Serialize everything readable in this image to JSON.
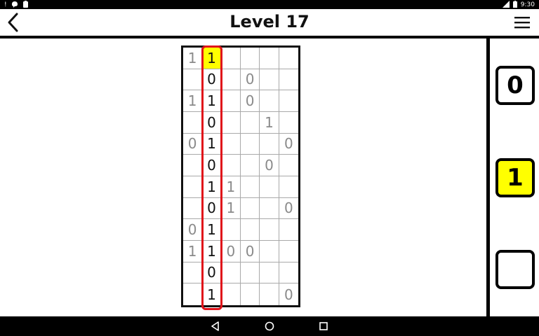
{
  "status_bar": {
    "left_icons": [
      "alert-icon",
      "messenger-icon",
      "clipboard-icon"
    ],
    "time": "9:30",
    "right_icons": [
      "signal-icon",
      "battery-icon"
    ]
  },
  "header": {
    "title": "Level 17",
    "back_icon": "chevron-left-icon",
    "menu_icon": "hamburger-menu-icon"
  },
  "board": {
    "columns": 6,
    "rows": 12,
    "cells": [
      [
        "1",
        "1",
        "",
        "",
        "",
        ""
      ],
      [
        "",
        "0",
        "",
        "0",
        "",
        ""
      ],
      [
        "1",
        "1",
        "",
        "0",
        "",
        ""
      ],
      [
        "",
        "0",
        "",
        "",
        "1",
        ""
      ],
      [
        "0",
        "1",
        "",
        "",
        "",
        "0"
      ],
      [
        "",
        "0",
        "",
        "",
        "0",
        ""
      ],
      [
        "",
        "1",
        "1",
        "",
        "",
        ""
      ],
      [
        "",
        "0",
        "1",
        "",
        "",
        "0"
      ],
      [
        "0",
        "1",
        "",
        "",
        "",
        ""
      ],
      [
        "1",
        "1",
        "0",
        "0",
        "",
        ""
      ],
      [
        "",
        "0",
        "",
        "",
        "",
        ""
      ],
      [
        "",
        "1",
        "",
        "",
        "",
        "0"
      ]
    ],
    "selected_cell": [
      0,
      1
    ],
    "highlighted_column": 1
  },
  "controls": {
    "zero_label": "0",
    "one_label": "1",
    "blank_label": ""
  },
  "colors": {
    "highlight": "#ffff00",
    "column_outline": "#e0121a",
    "filled_text": "#111111",
    "given_text": "#8a8a8a"
  },
  "nav_bar": {
    "icons": [
      "back-triangle-icon",
      "home-circle-icon",
      "recents-square-icon"
    ]
  }
}
